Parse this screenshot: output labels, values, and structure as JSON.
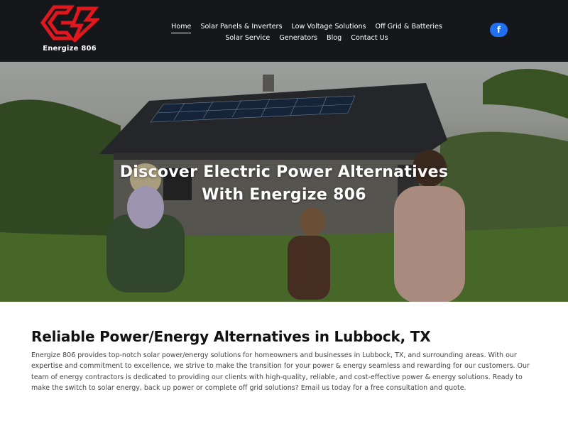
{
  "brand": {
    "name": "Energize 806",
    "logo_color": "#e1171e"
  },
  "nav": {
    "row1": [
      {
        "label": "Home",
        "active": true
      },
      {
        "label": "Solar Panels & Inverters"
      },
      {
        "label": "Low Voltage Solutions"
      },
      {
        "label": "Off Grid & Batteries"
      }
    ],
    "row2": [
      {
        "label": "Solar Service"
      },
      {
        "label": "Generators"
      },
      {
        "label": "Blog"
      },
      {
        "label": "Contact Us"
      }
    ]
  },
  "social": {
    "facebook_glyph": "f",
    "facebook_color": "#1f6ff0"
  },
  "hero": {
    "title_line1": "Discover Electric Power Alternatives",
    "title_line2": "With Energize 806"
  },
  "main": {
    "heading": "Reliable Power/Energy Alternatives in Lubbock, TX",
    "body": "Energize 806 provides top-notch solar power/energy solutions for homeowners and businesses in Lubbock, TX, and surrounding areas. With our expertise and commitment to excellence, we strive to make the transition for your power & energy seamless and rewarding for our customers. Our team of energy contractors is dedicated to providing our clients with high-quality, reliable, and cost-effective power & energy solutions. Ready to make the switch to solar energy, back up power or complete off grid solutions? Email us today for a free consultation and quote."
  }
}
